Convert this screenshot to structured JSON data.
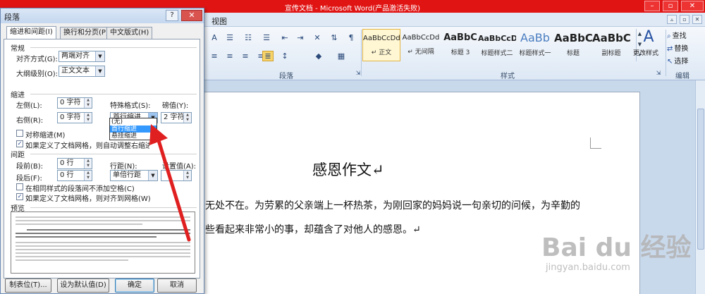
{
  "window": {
    "title": "宣传文档 - Microsoft Word(产品激活失败)",
    "tab_view": "视图",
    "controls": [
      "–",
      "▫",
      "✕"
    ]
  },
  "ribbon": {
    "paragraph_group_label": "段落",
    "styles_group_label": "样式",
    "edit_group_label": "编辑",
    "styles": [
      {
        "preview": "AaBbCcDd",
        "name": "↵ 正文",
        "selected": true
      },
      {
        "preview": "AaBbCcDd",
        "name": "↵ 无间隔",
        "selected": false
      },
      {
        "preview": "AaBbC",
        "name": "标题 3",
        "selected": false
      },
      {
        "preview": "AaBbCcD",
        "name": "标题样式二",
        "selected": false
      },
      {
        "preview": "AaBb",
        "name": "标题样式一",
        "selected": false
      },
      {
        "preview": "AaBbC",
        "name": "标题",
        "selected": false
      },
      {
        "preview": "AaBbC",
        "name": "副标题",
        "selected": false
      }
    ],
    "change_styles_label": "更改样式",
    "find_label": "查找",
    "replace_label": "替换",
    "select_label": "选择"
  },
  "document": {
    "title": "感恩作文↵",
    "line1": "无处不在。为劳累的父亲端上一杯热茶，为刚回家的妈妈说一句亲切的问候，为辛勤的",
    "line2": "些看起来非常小的事，却蕴含了对他人的感恩。↵"
  },
  "watermark": {
    "logo": "Bai du 经验",
    "url": "jingyan.baidu.com"
  },
  "dialog": {
    "title": "段落",
    "help": "?",
    "close": "✕",
    "tabs": [
      "缩进和间距(I)",
      "换行和分页(P)",
      "中文版式(H)"
    ],
    "general": {
      "section": "常规",
      "alignment_label": "对齐方式(G):",
      "alignment_value": "两端对齐",
      "outline_label": "大纲级别(O):",
      "outline_value": "正文文本"
    },
    "indent": {
      "section": "缩进",
      "left_label": "左侧(L):",
      "left_value": "0 字符",
      "right_label": "右侧(R):",
      "right_value": "0 字符",
      "special_label": "特殊格式(S):",
      "special_value": "首行缩进",
      "by_label": "磅值(Y):",
      "by_value": "2 字符",
      "mirror_label": "对称缩进(M)",
      "auto_adjust_label": "如果定义了文档网格，则自动调整右缩进(D)",
      "dropdown_options": [
        "(无)",
        "首行缩进",
        "悬挂缩进"
      ]
    },
    "spacing": {
      "section": "间距",
      "before_label": "段前(B):",
      "before_value": "0 行",
      "after_label": "段后(F):",
      "after_value": "0 行",
      "line_spacing_label": "行距(N):",
      "line_spacing_value": "单倍行距",
      "at_label": "设置值(A):",
      "no_space_label": "在相同样式的段落间不添加空格(C)",
      "snap_grid_label": "如果定义了文档网格，则对齐到网格(W)"
    },
    "preview_section": "预览",
    "buttons": {
      "tabs": "制表位(T)...",
      "set_default": "设为默认值(D)",
      "ok": "确定",
      "cancel": "取消"
    }
  }
}
